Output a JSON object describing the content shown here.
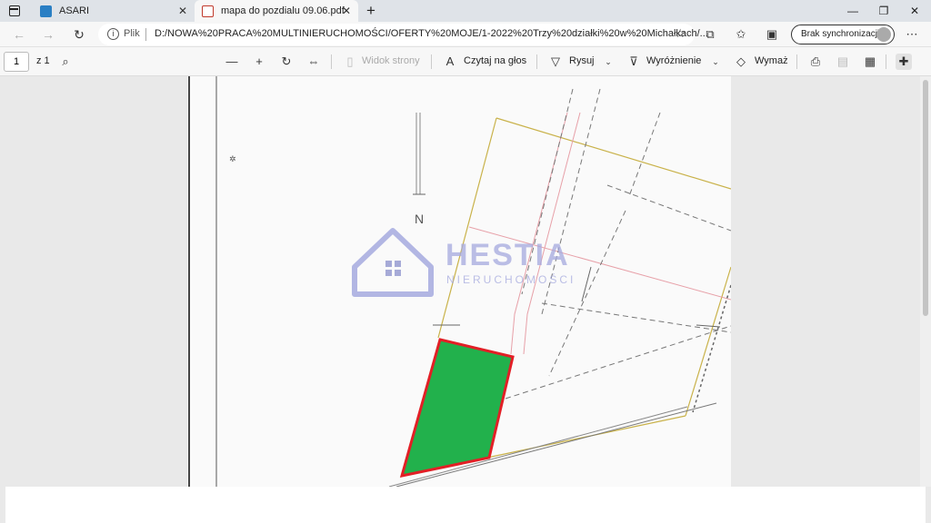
{
  "tabs": [
    {
      "label": "ASARI",
      "icon": "asari-favicon"
    },
    {
      "label": "mapa do pozdialu 09.06.pdf",
      "icon": "pdf-icon",
      "active": true
    }
  ],
  "address": {
    "scheme_label": "Plik",
    "url": "D:/NOWA%20PRACA%20MULTINIERUCHOMOŚCI/OFERTY%20MOJE/1-2022%20Trzy%20działki%20w%20Michałkach/...",
    "sync_label": "Brak synchronizacji"
  },
  "pdf_toolbar": {
    "page_number": "1",
    "page_total": "z 1",
    "view_label": "Widok strony",
    "read_aloud_label": "Czytaj na głos",
    "draw_label": "Rysuj",
    "highlight_label": "Wyróżnienie",
    "erase_label": "Wymaż"
  },
  "map": {
    "north_label": "N",
    "watermark_title": "HESTIA",
    "watermark_subtitle": "NIERUCHOMOŚCI",
    "parcel_color": "#22b14c",
    "parcel_border": "#e21f26"
  }
}
